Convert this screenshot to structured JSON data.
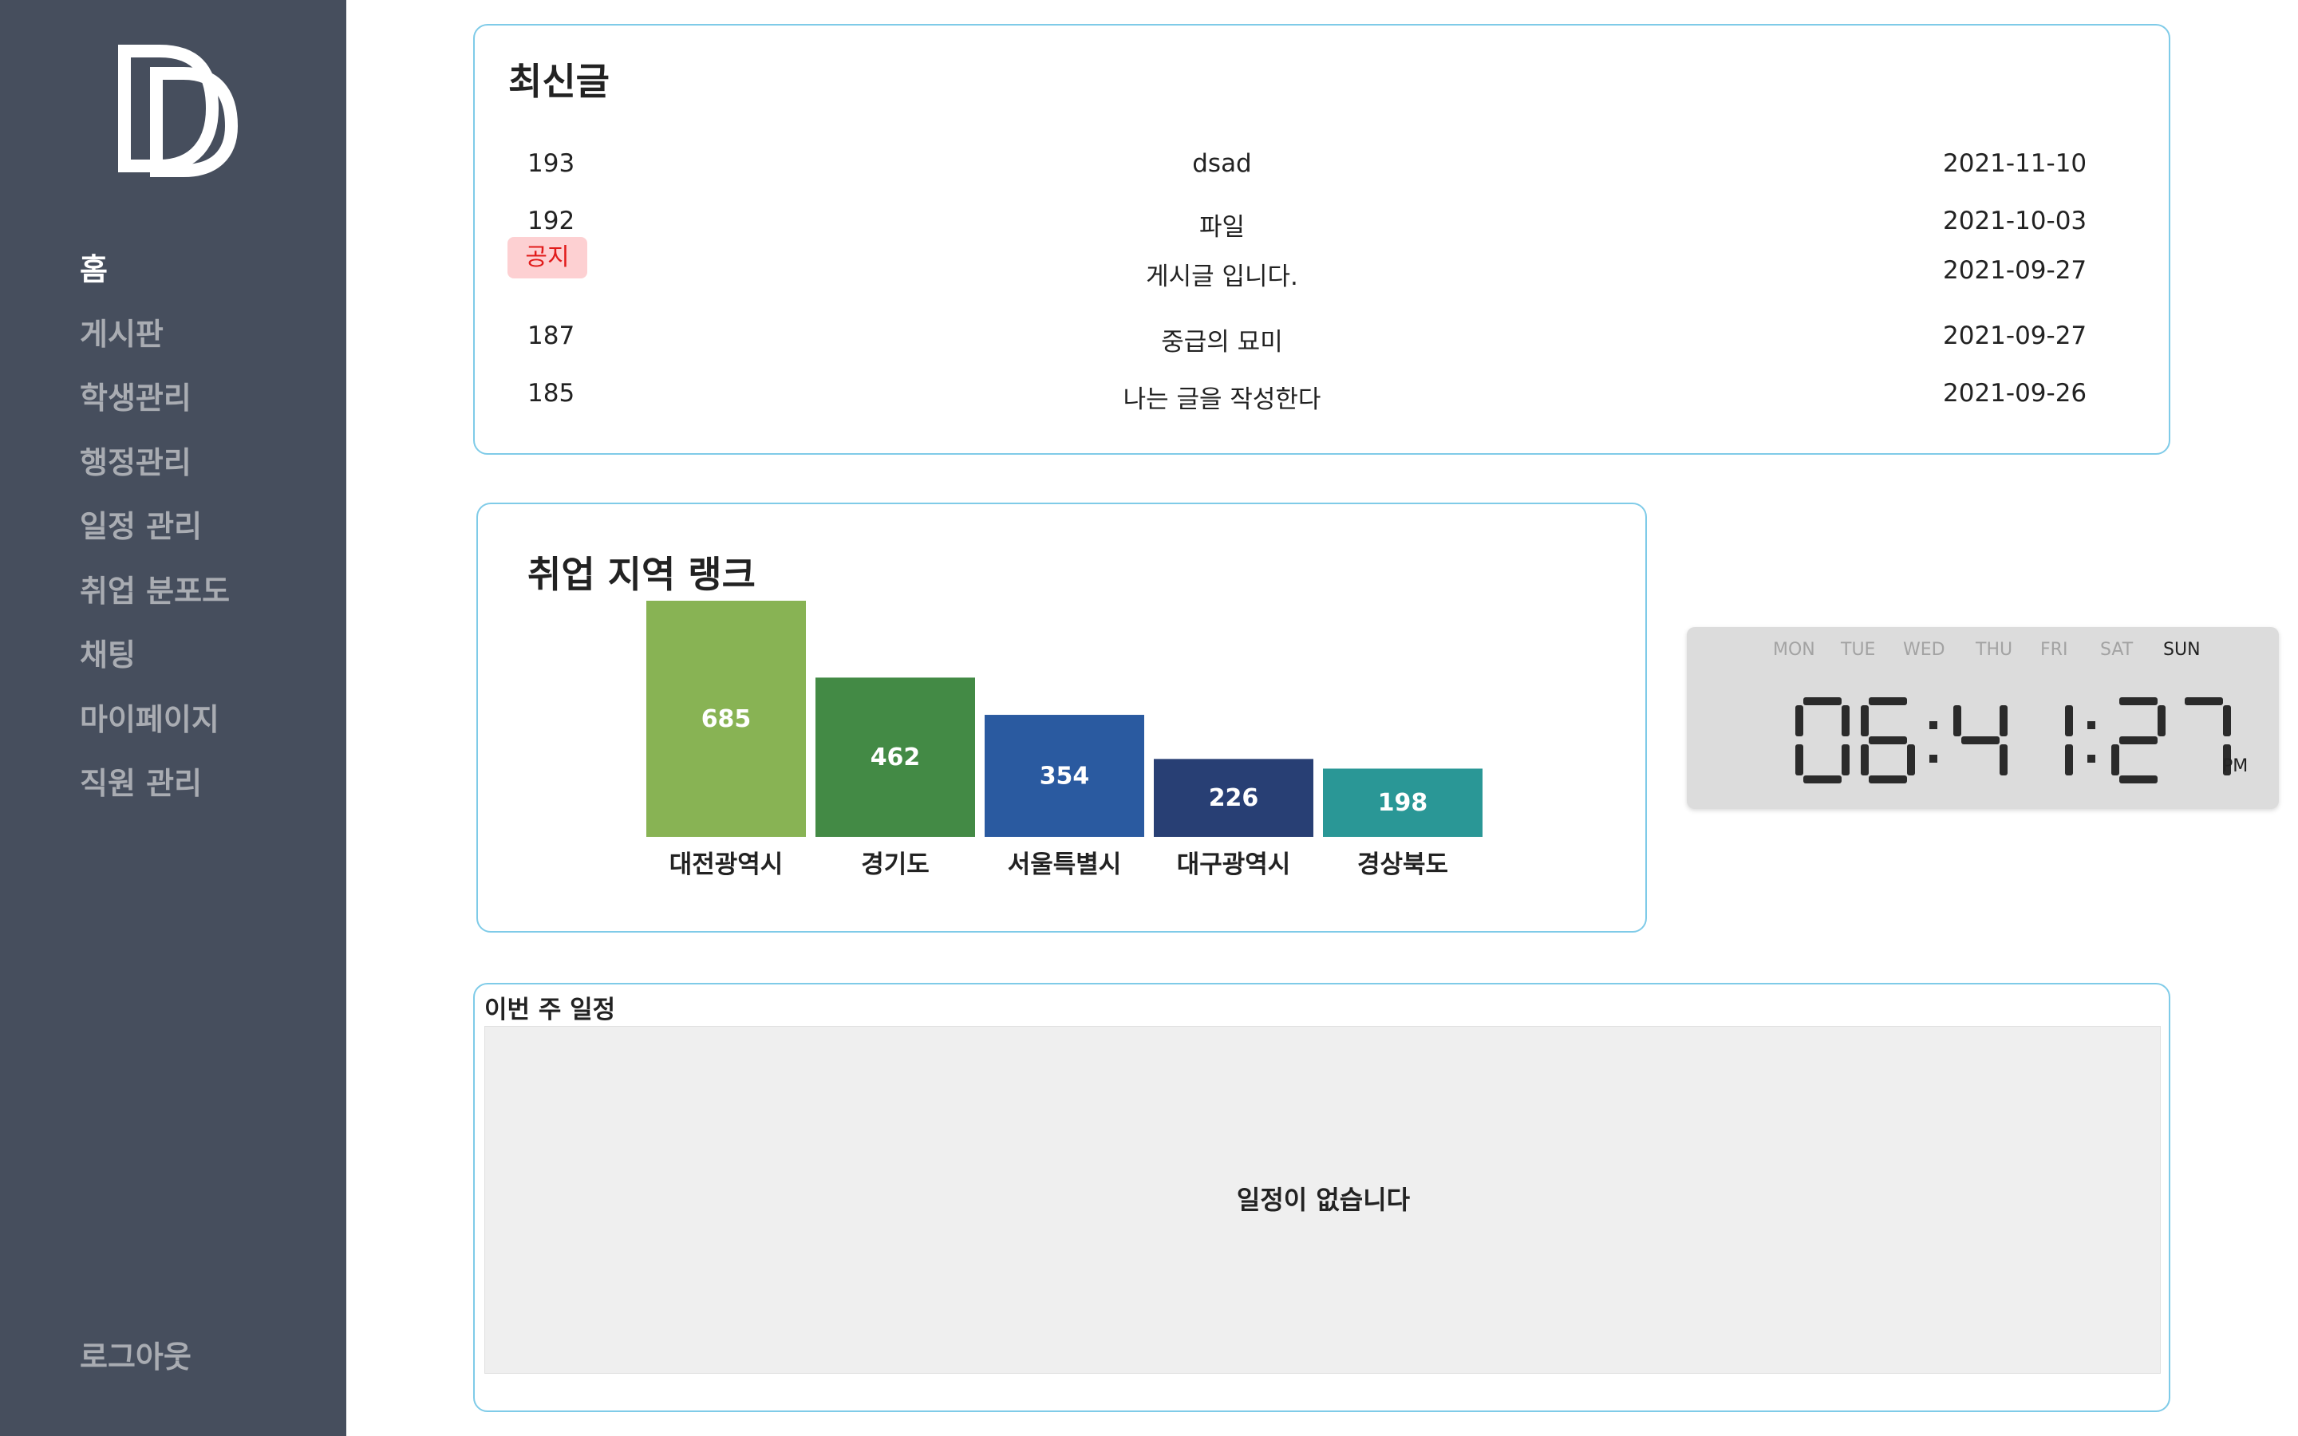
{
  "sidebar": {
    "logo": "DD",
    "items": [
      {
        "label": "홈",
        "active": true
      },
      {
        "label": "게시판",
        "active": false
      },
      {
        "label": "학생관리",
        "active": false
      },
      {
        "label": "행정관리",
        "active": false
      },
      {
        "label": "일정 관리",
        "active": false
      },
      {
        "label": "취업 분포도",
        "active": false
      },
      {
        "label": "채팅",
        "active": false
      },
      {
        "label": "마이페이지",
        "active": false
      },
      {
        "label": "직원 관리",
        "active": false
      }
    ],
    "logout": "로그아웃"
  },
  "recent": {
    "title": "최신글",
    "posts": [
      {
        "num": "193",
        "title": "dsad",
        "date": "2021-11-10"
      },
      {
        "num": "192",
        "title": "파일",
        "date": "2021-10-03"
      },
      {
        "num": "공지",
        "title": "게시글 입니다.",
        "date": "2021-09-27",
        "notice": true
      },
      {
        "num": "187",
        "title": "중급의 묘미",
        "date": "2021-09-27"
      },
      {
        "num": "185",
        "title": "나는 글을 작성한다",
        "date": "2021-09-26"
      }
    ]
  },
  "chart_data": {
    "type": "bar",
    "title": "취업 지역 랭크",
    "categories": [
      "대전광역시",
      "경기도",
      "서울특별시",
      "대구광역시",
      "경상북도"
    ],
    "values": [
      685,
      462,
      354,
      226,
      198
    ],
    "colors": [
      "#88b354",
      "#438a45",
      "#2a5aa0",
      "#283f74",
      "#2a9796"
    ],
    "xlabel": "",
    "ylabel": "",
    "ylim": [
      0,
      685
    ],
    "grid": false,
    "legend": "none"
  },
  "clock": {
    "days": [
      "MON",
      "TUE",
      "WED",
      "THU",
      "FRI",
      "SAT",
      "SUN"
    ],
    "active_day": "SUN",
    "time": "06:41:27",
    "ampm": "PM"
  },
  "schedule": {
    "title": "이번 주 일정",
    "empty": "일정이 없습니다"
  }
}
